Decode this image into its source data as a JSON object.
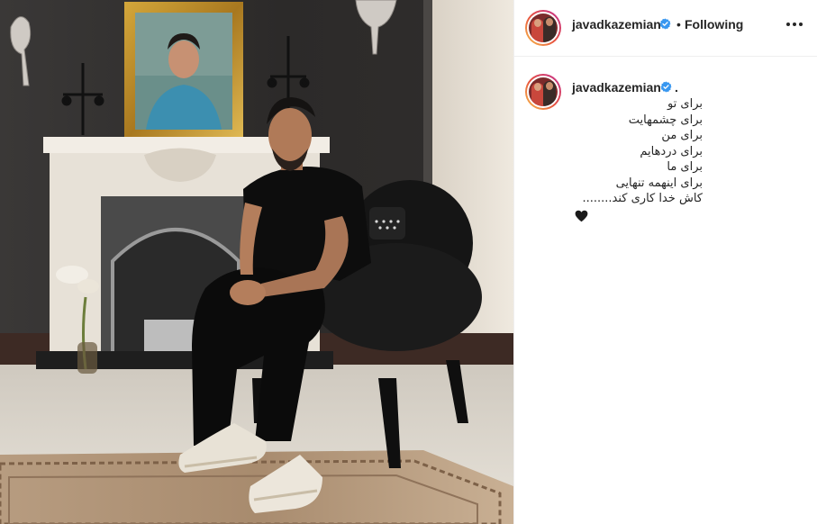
{
  "post": {
    "username": "javadkazemian",
    "separator": "•",
    "follow_status": "Following",
    "more_options_icon": "more-horizontal-icon",
    "verified_icon": "verified-badge-icon"
  },
  "caption": {
    "username": "javadkazemian",
    "trailing": ".",
    "lines": [
      "برای تو",
      "برای چشمهایت",
      "برای من",
      "برای دردهایم",
      "برای ما",
      "برای اینهمه تنهایی",
      "کاش خدا کاری کند........"
    ],
    "emoji_icon": "black-heart-icon"
  },
  "colors": {
    "verified_blue": "#3897f0",
    "text": "#262626",
    "divider": "#efefef",
    "avatar_ring_start": "#f9c24b",
    "avatar_ring_end": "#c32c8f"
  }
}
